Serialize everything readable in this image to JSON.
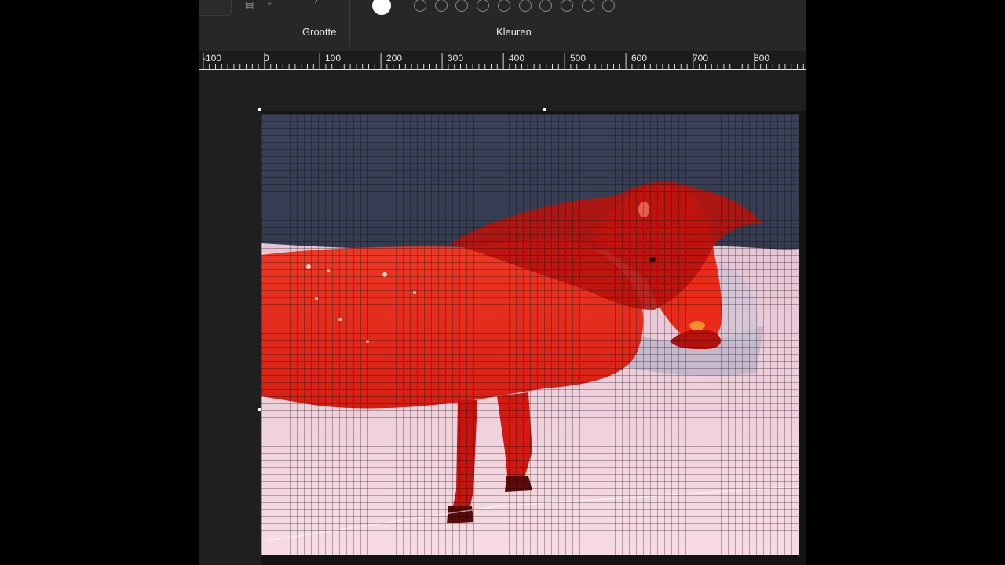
{
  "ribbon": {
    "groups": [
      {
        "label": "Grootte"
      },
      {
        "label": "Kleuren"
      }
    ],
    "swatch_count": 10,
    "selected_color": "#ffffff"
  },
  "ruler": {
    "labels": [
      "-100",
      "0",
      "100",
      "200",
      "300",
      "400",
      "500",
      "600",
      "700",
      "800"
    ]
  },
  "canvas": {
    "image_subject": "pony-in-snow",
    "tint_color": "#e0281a",
    "background_color": "#2b3244",
    "snow_color": "#efc6d2"
  },
  "colors": {
    "app_bg": "#1f1f1f",
    "ribbon_bg": "#272727",
    "text": "#e6e6e6"
  }
}
